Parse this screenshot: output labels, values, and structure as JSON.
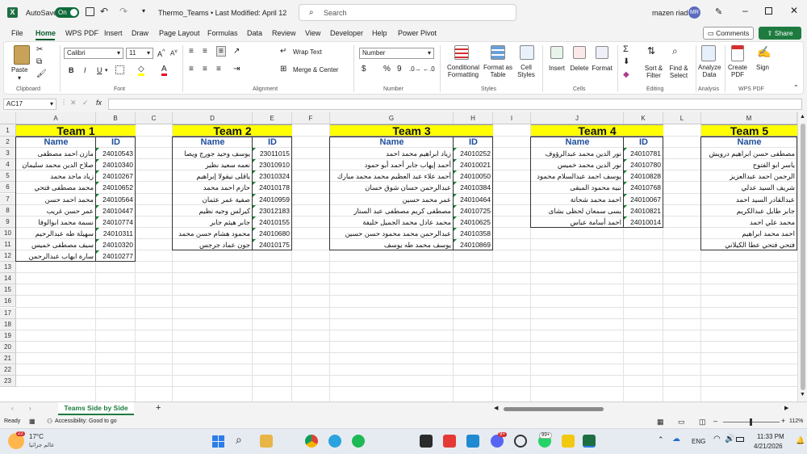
{
  "titlebar": {
    "autosave": "AutoSave",
    "toggle": "On",
    "doc_title": "Thermo_Teams • Last Modified: April 12",
    "search": "Search",
    "user": "mazen riad",
    "initials": "MR"
  },
  "menu": [
    "File",
    "Home",
    "WPS PDF",
    "Insert",
    "Draw",
    "Page Layout",
    "Formulas",
    "Data",
    "Review",
    "View",
    "Developer",
    "Help",
    "Power Pivot"
  ],
  "comments": "Comments",
  "share": "Share",
  "ribbon": {
    "clipboard": "Clipboard",
    "paste": "Paste",
    "font_grp": "Font",
    "font": "Calibri",
    "size": "11",
    "bold": "B",
    "italic": "I",
    "underline": "U",
    "alignment": "Alignment",
    "wrap": "Wrap Text",
    "merge": "Merge & Center",
    "number_grp": "Number",
    "number_fmt": "Number",
    "pct": "%",
    "comma": "9",
    "styles": "Styles",
    "cond": "Conditional Formatting",
    "fmt_table": "Format as Table",
    "cell_styles": "Cell Styles",
    "cells": "Cells",
    "insert": "Insert",
    "delete": "Delete",
    "format": "Format",
    "editing": "Editing",
    "sort": "Sort & Filter",
    "find": "Find & Select",
    "analysis": "Analysis",
    "analyze": "Analyze Data",
    "wpspdf": "WPS PDF",
    "create_pdf": "Create PDF",
    "sign": "Sign"
  },
  "namebox": "AC17",
  "fx": "fx",
  "columns": [
    "A",
    "B",
    "C",
    "D",
    "E",
    "F",
    "G",
    "H",
    "I",
    "J",
    "K",
    "L",
    "M"
  ],
  "rows": [
    "1",
    "2",
    "3",
    "4",
    "5",
    "6",
    "7",
    "8",
    "9",
    "10",
    "11",
    "12",
    "13",
    "14",
    "15",
    "16",
    "17",
    "18",
    "19",
    "20",
    "21",
    "22",
    "23"
  ],
  "teams": [
    {
      "title": "Team 1",
      "name_h": "Name",
      "id_h": "ID",
      "members": [
        [
          "مازن احمد مصطفى",
          "24010543"
        ],
        [
          "صلاح الدين محمد سليمان",
          "24010340"
        ],
        [
          "زياد ماجد محمد",
          "24010267"
        ],
        [
          "محمد مصطفى فتحي",
          "24010652"
        ],
        [
          "محمد احمد حسن",
          "24010564"
        ],
        [
          "عمر حسن غريب",
          "24010447"
        ],
        [
          "نسمة محمد ابوالوفا",
          "24010774"
        ],
        [
          "سهيلة طه عبدالرحيم",
          "24010311"
        ],
        [
          "سيف مصطفى خميس",
          "24010320"
        ],
        [
          "سارة ايهاب عبدالرحمن",
          "24010277"
        ]
      ]
    },
    {
      "title": "Team 2",
      "name_h": "Name",
      "id_h": "ID",
      "members": [
        [
          "يوسف وحيد جورج ويصا",
          "23011015"
        ],
        [
          "نعمه سعيد نظير",
          "23010910"
        ],
        [
          "ياقلى نيقولا إبراهيم",
          "23010324"
        ],
        [
          "حازم احمد محمد",
          "24010178"
        ],
        [
          "صفية عمر عثمان",
          "24010959"
        ],
        [
          "كيرلس وجيه نظيم",
          "23012183"
        ],
        [
          "جابر هيثم جابر",
          "24010155"
        ],
        [
          "محمود هشام حسن محمد",
          "24010680"
        ],
        [
          "جون عماد جرجس",
          "24010175"
        ]
      ]
    },
    {
      "title": "Team 3",
      "name_h": "Name",
      "id_h": "ID",
      "members": [
        [
          "زياد ابراهيم محمد احمد",
          "24010252"
        ],
        [
          "أحمد إيهاب جابر أحمد أبو حمود",
          "24010021"
        ],
        [
          "أحمد علاء عبد العظيم محمد محمد مبارك",
          "24010050"
        ],
        [
          "عبدالرحمن حسان شوق حسان",
          "24010384"
        ],
        [
          "عمر محمد حسين",
          "24010464"
        ],
        [
          "مصطفى كريم مصطفى عبد الستار",
          "24010725"
        ],
        [
          "محمد عادل محمد الجميل خليفة",
          "24010625"
        ],
        [
          "عبدالرحمن محمد محمود حسن حسين",
          "24010358"
        ],
        [
          "يوسف محمد طه يوسف",
          "24010869"
        ]
      ]
    },
    {
      "title": "Team 4",
      "name_h": "Name",
      "id_h": "ID",
      "members": [
        [
          "نور الدين محمد عبدالرؤوف",
          "24010781"
        ],
        [
          "نور الدين محمد خميس",
          "24010780"
        ],
        [
          "يوسف احمد عبدالسلام محمود",
          "24010828"
        ],
        [
          "نبيه محمود المبقى",
          "24010768"
        ],
        [
          "احمد محمد شحاتة",
          "24010067"
        ],
        [
          "يسى سمعان لحظى بشاى",
          "24010821"
        ],
        [
          "احمد أسامة عباس",
          "24010014"
        ]
      ]
    },
    {
      "title": "Team 5",
      "name_h": "Name",
      "members": [
        "مصطفى حسن ابراهيم درويش",
        "ياسر ابو الفتوح",
        "الرحمن احمد عبدالعزيز",
        "شريف السيد عدلي",
        "عبدالقادر السيد احمد",
        "جابر طايل عبدالكريم",
        "محمد علي احمد",
        "احمد محمد ابراهيم",
        "فتحي فتحي عطا الكيلاني"
      ]
    }
  ],
  "sheet_tab": "Teams Side by Side",
  "add_sheet": "+",
  "status": {
    "ready": "Ready",
    "accessibility": "Accessibility: Good to go",
    "zoom": "112%"
  },
  "taskbar": {
    "temp": "17°C",
    "weather": "عالم جراثيا",
    "lang": "ENG",
    "time": "11:33 PM",
    "date": "4/21/2026",
    "badge1": "99+",
    "badge2": "9+",
    "badge3": "22"
  }
}
